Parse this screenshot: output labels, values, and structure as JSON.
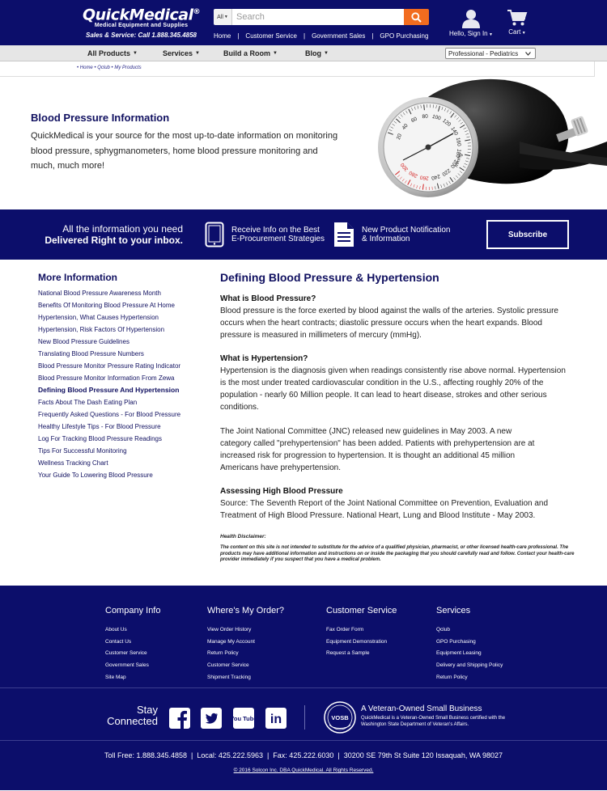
{
  "header": {
    "brand": "QuickMedical",
    "brand_mark": "®",
    "tagline": "Medical Equipment and Supplies",
    "sales_line": "Sales & Service: Call 1.888.345.4858",
    "search": {
      "category": "All",
      "placeholder": "Search"
    },
    "nav": [
      "Home",
      "Customer Service",
      "Government Sales",
      "GPO Purchasing"
    ],
    "account_label": "Hello, Sign In",
    "cart_label": "Cart"
  },
  "catnav": {
    "items": [
      "All Products",
      "Services",
      "Build a Room",
      "Blog"
    ],
    "specialty_selected": "Professional - Pediatrics"
  },
  "breadcrumb": "• Home • Qclub • My Products",
  "hero": {
    "title": "Blood Pressure Information",
    "text": "QuickMedical is your source for the most up-to-date information on monitoring blood pressure, sphygmanometers, home blood pressure monitoring and much, much more!"
  },
  "gauge_labels": [
    "20",
    "40",
    "60",
    "80",
    "100",
    "120",
    "140",
    "160",
    "180",
    "200",
    "220",
    "240",
    "260",
    "280",
    "300"
  ],
  "gauge_unit": "mmHg",
  "newsletter": {
    "line1": "All the information you need",
    "line2": "Delivered Right to your inbox.",
    "item1": "Receive Info on the Best E-Procurement Strategies",
    "item2": "New Product Notification & Information",
    "button": "Subscribe"
  },
  "sidebar": {
    "title": "More Information",
    "links": [
      "National Blood Pressure Awareness Month",
      "Benefits Of Monitoring Blood Pressure At Home",
      "Hypertension, What Causes Hypertension",
      "Hypertension, Risk Factors Of Hypertension",
      "New Blood Pressure Guidelines",
      "Translating Blood Pressure Numbers",
      "Blood Pressure Monitor Pressure Rating Indicator",
      "Blood Pressure Monitor Information From Zewa",
      "Defining Blood Pressure And Hypertension",
      "Facts About The Dash Eating Plan",
      "Frequently Asked Questions - For Blood Pressure",
      "Healthy Lifestyle Tips - For Blood Pressure",
      "Log For Tracking Blood Pressure Readings",
      "Tips For Successful Monitoring",
      "Wellness Tracking Chart",
      "Your Guide To Lowering Blood Pressure"
    ],
    "active_index": 8
  },
  "article": {
    "title": "Defining Blood Pressure & Hypertension",
    "s1_heading": "What is Blood Pressure?",
    "s1_text": "Blood pressure is the force exerted by blood against the walls of the arteries. Systolic pressure occurs when the heart contracts; diastolic pressure occurs when the heart expands. Blood pressure is measured in millimeters of mercury (mmHg).",
    "s2_heading": "What is Hypertension?",
    "s2_text": "Hypertension is the diagnosis given when readings consistently rise above normal. Hypertension is the most under treated cardiovascular condition in the U.S., affecting roughly 20% of the population - nearly 60 Million people. It can lead to heart disease, strokes and other serious conditions.",
    "s3_text": "The Joint National Committee (JNC) released new guidelines in May 2003. A new category called \"prehypertension\" has been added. Patients with prehypertension are at increased risk for progression to hypertension. It is thought an additional 45 million Americans have prehypertension.",
    "s4_heading": "Assessing High Blood Pressure",
    "s4_text": "Source: The Seventh Report of the Joint National Committee on Prevention, Evaluation and Treatment of High Blood Pressure. National Heart, Lung and Blood Institute - May 2003.",
    "disclaimer_heading": "Health Disclaimer:",
    "disclaimer_text": "The content on this site is not intended to substitute for the advice of a qualified physician, pharmacist, or other licensed health-care professional. The products may have additional information and instructions on or inside the packaging that you should carefully read and follow. Contact your health-care provider immediately if you suspect that you have a medical problem."
  },
  "footer": {
    "columns": [
      {
        "title": "Company Info",
        "links": [
          "About Us",
          "Contact Us",
          "Customer Service",
          "Government Sales",
          "Site Map"
        ]
      },
      {
        "title": "Where's My Order?",
        "links": [
          "View Order History",
          "Manage My Account",
          "Return Policy",
          "Customer Service",
          "Shipment Tracking"
        ]
      },
      {
        "title": "Customer Service",
        "links": [
          "Fax Order Form",
          "Equipment Demonstration",
          "Request a Sample"
        ]
      },
      {
        "title": "Services",
        "links": [
          "Qclub",
          "GPO Purchasing",
          "Equipment Leasing",
          "Delivery and Shipping Policy",
          "Return Policy"
        ]
      }
    ],
    "stay_line1": "Stay",
    "stay_line2": "Connected",
    "social": [
      "facebook-icon",
      "twitter-icon",
      "youtube-icon",
      "linkedin-icon"
    ],
    "youtube_text": "You Tube",
    "linkedin_text": "in",
    "vosb_badge": "VOSB",
    "veteran_title": "A Veteran-Owned Small Business",
    "veteran_text": "QuickMedical is a Veteran-Owned Small Business certified with the Washington State Department of Veteran's Affairs.",
    "contact": "Toll Free: 1.888.345.4858  |  Local: 425.222.5963  |  Fax: 425.222.6030  |  30200 SE 79th St Suite 120 Issaquah, WA 98027",
    "copyright": "© 2016 Solcon Inc. DBA QuickMedical. All Rights Reserved."
  },
  "colors": {
    "navy": "#0c0e6b",
    "orange": "#f26c1f",
    "gray_nav": "#e6e6e6",
    "gauge_red": "#d42020"
  }
}
